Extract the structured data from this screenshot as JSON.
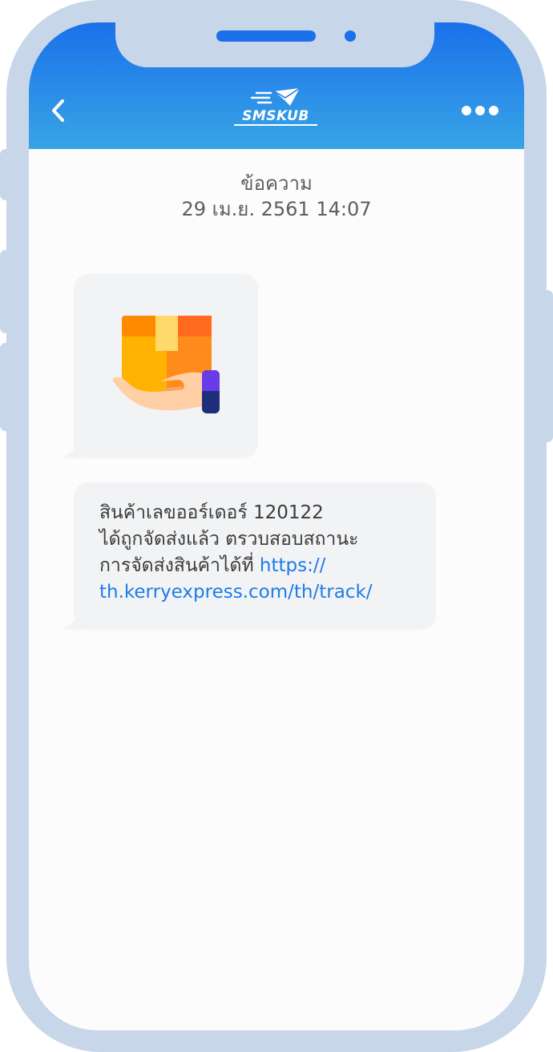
{
  "header": {
    "logo_text": "SMSKUB",
    "back_icon": "chevron-left-icon",
    "more_icon": "more-horizontal-icon"
  },
  "conversation": {
    "contact_name": "ข้อความ",
    "timestamp": "29 เม.ย. 2561 14:07"
  },
  "messages": [
    {
      "type": "image",
      "icon": "parcel-hand-icon"
    },
    {
      "type": "text",
      "text": "สินค้าเลขออร์เดอร์ 120122\nได้ถูกจัดส่งแล้ว ตรวบสอบสถานะ\nการจัดส่งสินค้าได้ที่ ",
      "link": "https://\nth.kerryexpress.com/th/track/"
    }
  ],
  "colors": {
    "header_top": "#1a71ea",
    "header_bottom": "#38a4e6",
    "frame": "#c8d6e9",
    "bubble": "#f2f3f5",
    "link": "#1d7ce8",
    "text": "#3b3b3b"
  }
}
